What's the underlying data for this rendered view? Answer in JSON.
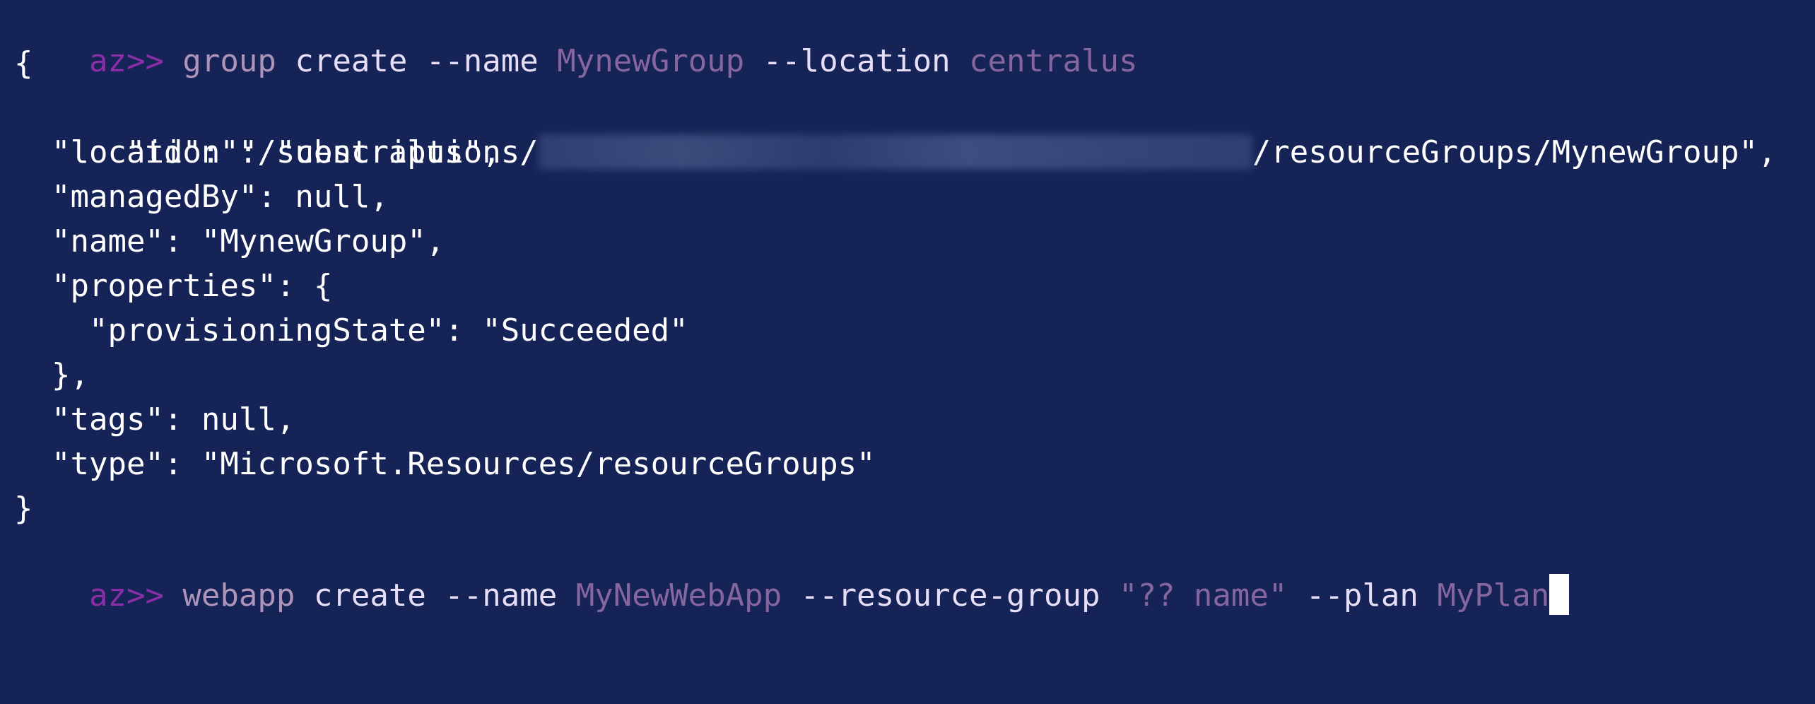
{
  "terminal": {
    "line1": {
      "prompt": "az>>",
      "parts": [
        {
          "text": " group",
          "role": "cmd"
        },
        {
          "text": " create",
          "role": "flag"
        },
        {
          "text": " --name",
          "role": "flag"
        },
        {
          "text": " MynewGroup",
          "role": "val"
        },
        {
          "text": " --location",
          "role": "flag"
        },
        {
          "text": " centralus",
          "role": "val"
        }
      ]
    },
    "json_output": {
      "open_brace": "{",
      "id_prefix": "  \"id\": \"/subscriptions/",
      "id_suffix": "/resourceGroups/MynewGroup\",",
      "location": "  \"location\": \"centralus\",",
      "managedBy": "  \"managedBy\": null,",
      "name": "  \"name\": \"MynewGroup\",",
      "properties_open": "  \"properties\": {",
      "provisioningState": "    \"provisioningState\": \"Succeeded\"",
      "properties_close": "  },",
      "tags": "  \"tags\": null,",
      "type": "  \"type\": \"Microsoft.Resources/resourceGroups\"",
      "close_brace": "}"
    },
    "line2": {
      "prompt": "az>>",
      "parts": [
        {
          "text": " webapp",
          "role": "cmd"
        },
        {
          "text": " create",
          "role": "flag"
        },
        {
          "text": " --name",
          "role": "flag"
        },
        {
          "text": " MyNewWebApp",
          "role": "val"
        },
        {
          "text": " --resource-group",
          "role": "flag"
        },
        {
          "text": " \"?? name\"",
          "role": "val"
        },
        {
          "text": " --plan",
          "role": "flag"
        },
        {
          "text": " MyPlan",
          "role": "val"
        }
      ]
    },
    "colors": {
      "background": "#162356",
      "prompt": "#8a2ea8",
      "command": "#ad94b9",
      "flag": "#e6ddf7",
      "value": "#86669f",
      "output": "#ffffff"
    }
  }
}
